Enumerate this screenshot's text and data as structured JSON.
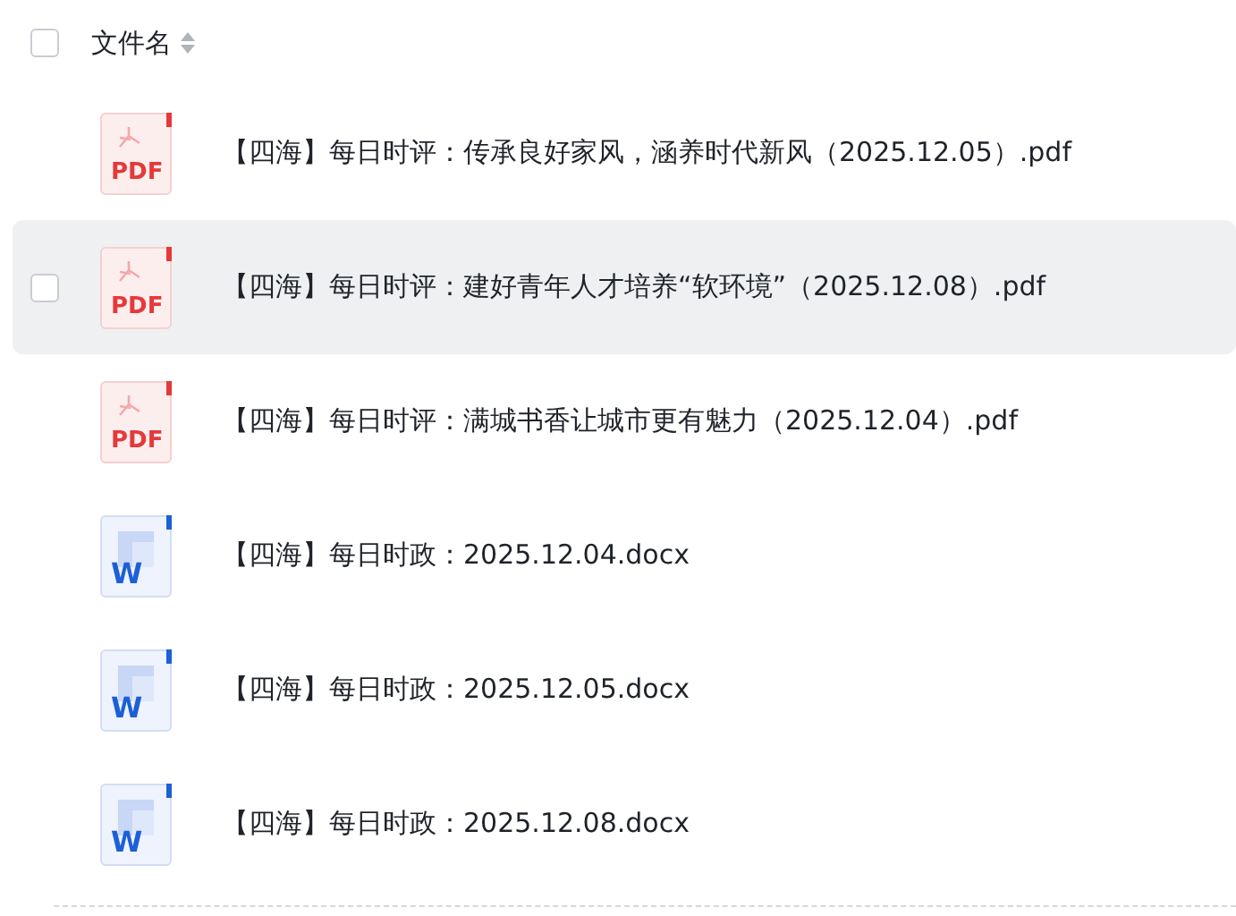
{
  "header": {
    "select_all_checked": false,
    "column": "文件名"
  },
  "files": [
    {
      "kind": "pdf",
      "icon_label": "PDF",
      "name": "【四海】每日时评：传承良好家风，涵养时代新风（2025.12.05）.pdf",
      "highlighted": false
    },
    {
      "kind": "pdf",
      "icon_label": "PDF",
      "name": "【四海】每日时评：建好青年人才培养“软环境”（2025.12.08）.pdf",
      "highlighted": true
    },
    {
      "kind": "pdf",
      "icon_label": "PDF",
      "name": "【四海】每日时评：满城书香让城市更有魅力（2025.12.04）.pdf",
      "highlighted": false
    },
    {
      "kind": "docx",
      "icon_label": "W",
      "name": "【四海】每日时政：2025.12.04.docx",
      "highlighted": false
    },
    {
      "kind": "docx",
      "icon_label": "W",
      "name": "【四海】每日时政：2025.12.05.docx",
      "highlighted": false
    },
    {
      "kind": "docx",
      "icon_label": "W",
      "name": "【四海】每日时政：2025.12.08.docx",
      "highlighted": false
    }
  ]
}
